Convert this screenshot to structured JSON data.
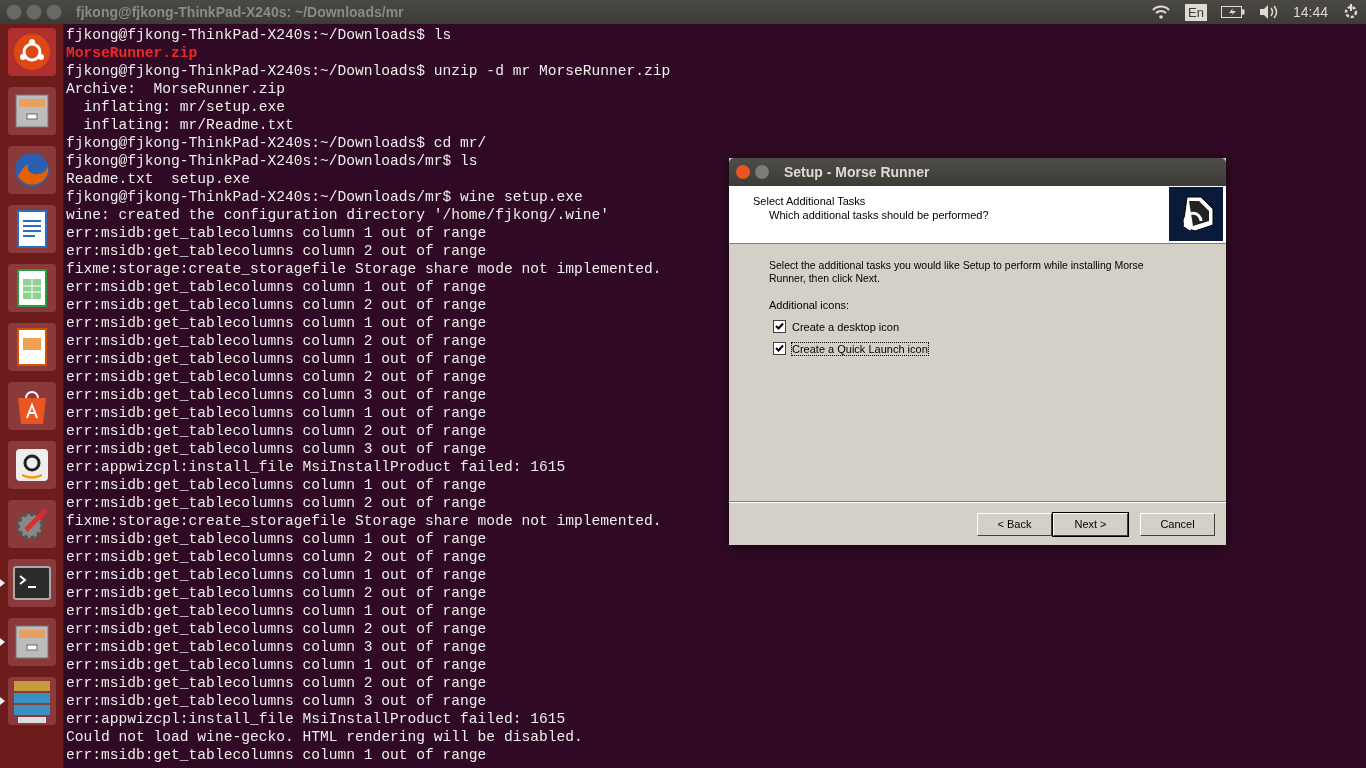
{
  "top_bar": {
    "window_title": "fjkong@fjkong-ThinkPad-X240s: ~/Downloads/mr",
    "keyboard_layout": "En",
    "clock": "14:44"
  },
  "launcher": [
    {
      "kind": "dash",
      "running": false
    },
    {
      "kind": "files",
      "running": false
    },
    {
      "kind": "browser",
      "running": false
    },
    {
      "kind": "writer",
      "running": false
    },
    {
      "kind": "calc",
      "running": false
    },
    {
      "kind": "impress",
      "running": false
    },
    {
      "kind": "software",
      "running": false
    },
    {
      "kind": "amazon",
      "running": false
    },
    {
      "kind": "settings",
      "running": false
    },
    {
      "kind": "terminal",
      "running": true
    },
    {
      "kind": "files",
      "running": true
    },
    {
      "kind": "stack",
      "running": true
    }
  ],
  "terminal_lines": [
    {
      "kind": "text",
      "text": "fjkong@fjkong-ThinkPad-X240s:~/Downloads$ ls"
    },
    {
      "kind": "archive",
      "text": "MorseRunner.zip"
    },
    {
      "kind": "text",
      "text": "fjkong@fjkong-ThinkPad-X240s:~/Downloads$ unzip -d mr MorseRunner.zip"
    },
    {
      "kind": "text",
      "text": "Archive:  MorseRunner.zip"
    },
    {
      "kind": "text",
      "text": "  inflating: mr/setup.exe"
    },
    {
      "kind": "text",
      "text": "  inflating: mr/Readme.txt"
    },
    {
      "kind": "text",
      "text": "fjkong@fjkong-ThinkPad-X240s:~/Downloads$ cd mr/"
    },
    {
      "kind": "text",
      "text": "fjkong@fjkong-ThinkPad-X240s:~/Downloads/mr$ ls"
    },
    {
      "kind": "text",
      "text": "Readme.txt  setup.exe"
    },
    {
      "kind": "text",
      "text": "fjkong@fjkong-ThinkPad-X240s:~/Downloads/mr$ wine setup.exe"
    },
    {
      "kind": "text",
      "text": "wine: created the configuration directory '/home/fjkong/.wine'"
    },
    {
      "kind": "text",
      "text": "err:msidb:get_tablecolumns column 1 out of range"
    },
    {
      "kind": "text",
      "text": "err:msidb:get_tablecolumns column 2 out of range"
    },
    {
      "kind": "text",
      "text": "fixme:storage:create_storagefile Storage share mode not implemented."
    },
    {
      "kind": "text",
      "text": "err:msidb:get_tablecolumns column 1 out of range"
    },
    {
      "kind": "text",
      "text": "err:msidb:get_tablecolumns column 2 out of range"
    },
    {
      "kind": "text",
      "text": "err:msidb:get_tablecolumns column 1 out of range"
    },
    {
      "kind": "text",
      "text": "err:msidb:get_tablecolumns column 2 out of range"
    },
    {
      "kind": "text",
      "text": "err:msidb:get_tablecolumns column 1 out of range"
    },
    {
      "kind": "text",
      "text": "err:msidb:get_tablecolumns column 2 out of range"
    },
    {
      "kind": "text",
      "text": "err:msidb:get_tablecolumns column 3 out of range"
    },
    {
      "kind": "text",
      "text": "err:msidb:get_tablecolumns column 1 out of range"
    },
    {
      "kind": "text",
      "text": "err:msidb:get_tablecolumns column 2 out of range"
    },
    {
      "kind": "text",
      "text": "err:msidb:get_tablecolumns column 3 out of range"
    },
    {
      "kind": "text",
      "text": "err:appwizcpl:install_file MsiInstallProduct failed: 1615"
    },
    {
      "kind": "text",
      "text": "err:msidb:get_tablecolumns column 1 out of range"
    },
    {
      "kind": "text",
      "text": "err:msidb:get_tablecolumns column 2 out of range"
    },
    {
      "kind": "text",
      "text": "fixme:storage:create_storagefile Storage share mode not implemented."
    },
    {
      "kind": "text",
      "text": "err:msidb:get_tablecolumns column 1 out of range"
    },
    {
      "kind": "text",
      "text": "err:msidb:get_tablecolumns column 2 out of range"
    },
    {
      "kind": "text",
      "text": "err:msidb:get_tablecolumns column 1 out of range"
    },
    {
      "kind": "text",
      "text": "err:msidb:get_tablecolumns column 2 out of range"
    },
    {
      "kind": "text",
      "text": "err:msidb:get_tablecolumns column 1 out of range"
    },
    {
      "kind": "text",
      "text": "err:msidb:get_tablecolumns column 2 out of range"
    },
    {
      "kind": "text",
      "text": "err:msidb:get_tablecolumns column 3 out of range"
    },
    {
      "kind": "text",
      "text": "err:msidb:get_tablecolumns column 1 out of range"
    },
    {
      "kind": "text",
      "text": "err:msidb:get_tablecolumns column 2 out of range"
    },
    {
      "kind": "text",
      "text": "err:msidb:get_tablecolumns column 3 out of range"
    },
    {
      "kind": "text",
      "text": "err:appwizcpl:install_file MsiInstallProduct failed: 1615"
    },
    {
      "kind": "text",
      "text": "Could not load wine-gecko. HTML rendering will be disabled."
    },
    {
      "kind": "text",
      "text": "err:msidb:get_tablecolumns column 1 out of range"
    }
  ],
  "dialog": {
    "title": "Setup - Morse Runner",
    "heading": "Select Additional Tasks",
    "subheading": "Which additional tasks should be performed?",
    "description": "Select the additional tasks you would like Setup to perform while installing Morse Runner, then click Next.",
    "group_label": "Additional icons:",
    "options": [
      {
        "label": "Create a desktop icon",
        "checked": true,
        "focused": false
      },
      {
        "label": "Create a Quick Launch icon",
        "checked": true,
        "focused": true
      }
    ],
    "buttons": [
      {
        "label": "< Back",
        "default": false
      },
      {
        "label": "Next >",
        "default": true
      },
      {
        "label": "Cancel",
        "default": false
      }
    ]
  }
}
